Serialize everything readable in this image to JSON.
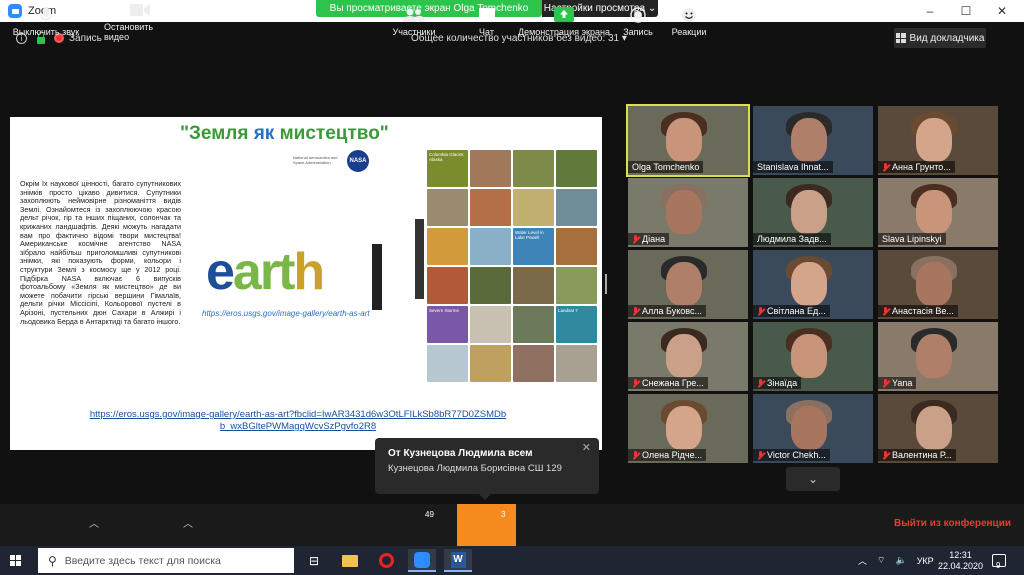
{
  "window": {
    "title": "Zoom",
    "minimize": "–",
    "maximize": "☐",
    "close": "✕"
  },
  "share_banner": {
    "text": "Вы просматриваете экран Olga Tomchenko",
    "view_settings": "Настройки просмотра ⌄"
  },
  "meeting_bar": {
    "record_label": "Запись",
    "participants_without_video": "Общее количество участников без видео: 31 ▾",
    "speaker_view": "Вид докладчика"
  },
  "slide": {
    "title_part1": "\"Земля ",
    "title_part2": "як",
    "title_part3": " мистецтво\"",
    "nasa_caption": "National Aeronautics and Space Administration",
    "nasa_logo": "NASA",
    "body": "Окрім їх наукової цінності, багато супутникових знімків просто цікаво дивитися. Супутники захоплюють неймовірне різноманіття видів Землі. Ознайомтеся із захоплюючою красою дельт річок, гір та інших піщаних, солончак та крижаних ландшафтів. Деякі можуть нагадати вам про фактично відомі твори мистецтва! Американське космічне агентство NASA зібрало найбільш приголомшливі супутникові знімки, які показують форми, кольори і структури Землі з космосу ще у 2012 році. Підбірка NASA включає 6 випусків фотоальбому «Земля як мистецтво» де ви можете побачити гірські вершини Гімалаїв, дельти річки Міссісіпі, Кольорової пустелі в Арізоні, пустельних дюн Сахари в Алжирі і льодовика Берда в Антарктиді та багато іншого.",
    "earth_logo": {
      "e": "e",
      "a": "art",
      "h": "h"
    },
    "url": "https://eros.usgs.gov/image-gallery/earth-as-art",
    "link": "https://eros.usgs.gov/image-gallery/earth-as-art?fbclid=IwAR3431d6w3OtLFILkSb8bR77D0ZSMDbb_wxBGltePWMagqWcvSzPgvfo2R8",
    "mosaic_labels": {
      "columbia": "Columbia Glacier, Alaska",
      "lake_powell": "Water Level in Lake Powell",
      "severe_storms": "Severe Storms",
      "landsat": "Landsat 7"
    }
  },
  "participants": [
    {
      "name": "Olga Tomchenko",
      "muted": false,
      "active": true
    },
    {
      "name": "Stanislava Ihnat...",
      "muted": false,
      "active": false
    },
    {
      "name": "Анна Грунто...",
      "muted": true,
      "active": false
    },
    {
      "name": "Діана",
      "muted": true,
      "active": false
    },
    {
      "name": "Людмила Задв...",
      "muted": false,
      "active": false
    },
    {
      "name": "Slava Lipinskyi",
      "muted": false,
      "active": false
    },
    {
      "name": "Алла Буковс...",
      "muted": true,
      "active": false
    },
    {
      "name": "Світлана Ед...",
      "muted": true,
      "active": false
    },
    {
      "name": "Анастасія Ве...",
      "muted": true,
      "active": false
    },
    {
      "name": "Снежана Гре...",
      "muted": true,
      "active": false
    },
    {
      "name": "Зінаїда",
      "muted": true,
      "active": false
    },
    {
      "name": "Yana",
      "muted": true,
      "active": false
    },
    {
      "name": "Олена Рідче...",
      "muted": true,
      "active": false
    },
    {
      "name": "Victor Chekh...",
      "muted": true,
      "active": false
    },
    {
      "name": "Валентина Р...",
      "muted": true,
      "active": false
    }
  ],
  "chat_popup": {
    "from": "От Кузнецова Людмила всем",
    "message": "Кузнецова Людмила Борисівна СШ 129",
    "close": "✕"
  },
  "toolbar": {
    "mute": "Выключить звук",
    "video": "Остановить видео",
    "participants": "Участники",
    "participants_count": "49",
    "chat": "Чат",
    "chat_count": "3",
    "share_screen": "Демонстрация экрана",
    "record": "Запись",
    "reactions": "Реакции",
    "leave": "Выйти из конференции"
  },
  "taskbar": {
    "search_placeholder": "Введите здесь текст для поиска",
    "lang": "УКР",
    "time": "12:31",
    "date": "22.04.2020",
    "notifications": "9"
  },
  "colors": {
    "accent_green": "#2dc44e",
    "chat_orange": "#f58a1f",
    "leave_red": "#e83b3b",
    "active_speaker": "#d8e04a"
  }
}
